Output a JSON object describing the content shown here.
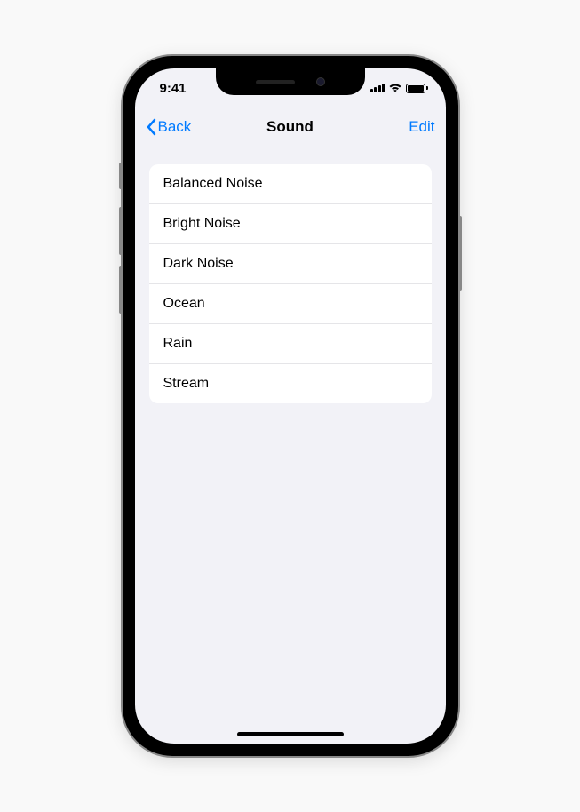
{
  "statusBar": {
    "time": "9:41"
  },
  "navBar": {
    "backLabel": "Back",
    "title": "Sound",
    "editLabel": "Edit"
  },
  "sounds": [
    {
      "label": "Balanced Noise"
    },
    {
      "label": "Bright Noise"
    },
    {
      "label": "Dark Noise"
    },
    {
      "label": "Ocean"
    },
    {
      "label": "Rain"
    },
    {
      "label": "Stream"
    }
  ]
}
